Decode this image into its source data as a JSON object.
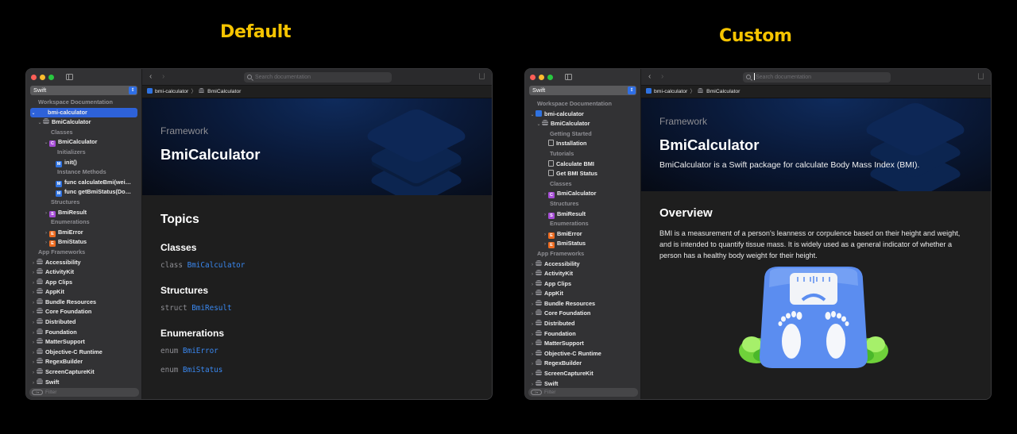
{
  "captions": {
    "left": "Default",
    "right": "Custom"
  },
  "windows": {
    "default": {
      "sidebar": {
        "language": "Swift",
        "filter_placeholder": "Filter",
        "tree": [
          {
            "label": "Workspace Documentation",
            "kind": "section",
            "indent": 0
          },
          {
            "label": "bmi-calculator",
            "kind": "item",
            "disclosure": "open",
            "icon": "none",
            "indent": 0,
            "selected": true
          },
          {
            "label": "BmiCalculator",
            "kind": "item",
            "disclosure": "open",
            "icon": "framework",
            "indent": 1
          },
          {
            "label": "Classes",
            "kind": "section",
            "indent": 2
          },
          {
            "label": "BmiCalculator",
            "kind": "item",
            "disclosure": "open",
            "icon": "C",
            "indent": 2
          },
          {
            "label": "Initializers",
            "kind": "section",
            "indent": 3
          },
          {
            "label": "init()",
            "kind": "item",
            "disclosure": "none",
            "icon": "M",
            "indent": 3
          },
          {
            "label": "Instance Methods",
            "kind": "section",
            "indent": 3
          },
          {
            "label": "func calculateBmi(wei…",
            "kind": "item",
            "disclosure": "none",
            "icon": "M",
            "indent": 3
          },
          {
            "label": "func getBmiStatus(Do…",
            "kind": "item",
            "disclosure": "none",
            "icon": "M",
            "indent": 3
          },
          {
            "label": "Structures",
            "kind": "section",
            "indent": 2
          },
          {
            "label": "BmiResult",
            "kind": "item",
            "disclosure": "closed",
            "icon": "S",
            "indent": 2
          },
          {
            "label": "Enumerations",
            "kind": "section",
            "indent": 2
          },
          {
            "label": "BmiError",
            "kind": "item",
            "disclosure": "closed",
            "icon": "E",
            "indent": 2
          },
          {
            "label": "BmiStatus",
            "kind": "item",
            "disclosure": "closed",
            "icon": "E",
            "indent": 2
          },
          {
            "label": "App Frameworks",
            "kind": "section",
            "indent": 0
          },
          {
            "label": "Accessibility",
            "kind": "item",
            "disclosure": "closed",
            "icon": "framework",
            "indent": 0
          },
          {
            "label": "ActivityKit",
            "kind": "item",
            "disclosure": "closed",
            "icon": "framework",
            "indent": 0
          },
          {
            "label": "App Clips",
            "kind": "item",
            "disclosure": "closed",
            "icon": "framework",
            "indent": 0
          },
          {
            "label": "AppKit",
            "kind": "item",
            "disclosure": "closed",
            "icon": "framework",
            "indent": 0
          },
          {
            "label": "Bundle Resources",
            "kind": "item",
            "disclosure": "closed",
            "icon": "framework",
            "indent": 0
          },
          {
            "label": "Core Foundation",
            "kind": "item",
            "disclosure": "closed",
            "icon": "framework",
            "indent": 0
          },
          {
            "label": "Distributed",
            "kind": "item",
            "disclosure": "closed",
            "icon": "framework",
            "indent": 0
          },
          {
            "label": "Foundation",
            "kind": "item",
            "disclosure": "closed",
            "icon": "framework",
            "indent": 0
          },
          {
            "label": "MatterSupport",
            "kind": "item",
            "disclosure": "closed",
            "icon": "framework",
            "indent": 0
          },
          {
            "label": "Objective-C Runtime",
            "kind": "item",
            "disclosure": "closed",
            "icon": "framework",
            "indent": 0
          },
          {
            "label": "RegexBuilder",
            "kind": "item",
            "disclosure": "closed",
            "icon": "framework",
            "indent": 0
          },
          {
            "label": "ScreenCaptureKit",
            "kind": "item",
            "disclosure": "closed",
            "icon": "framework",
            "indent": 0
          },
          {
            "label": "Swift",
            "kind": "item",
            "disclosure": "closed",
            "icon": "framework",
            "indent": 0
          }
        ]
      },
      "toolbar": {
        "search_placeholder": "Search documentation",
        "search_focused": false
      },
      "breadcrumb": {
        "package": "bmi-calculator",
        "module": "BmiCalculator"
      },
      "hero": {
        "eyebrow": "Framework",
        "title": "BmiCalculator"
      },
      "topics": {
        "title": "Topics",
        "groups": [
          {
            "heading": "Classes",
            "items": [
              {
                "keyword": "class",
                "name": "BmiCalculator"
              }
            ]
          },
          {
            "heading": "Structures",
            "items": [
              {
                "keyword": "struct",
                "name": "BmiResult"
              }
            ]
          },
          {
            "heading": "Enumerations",
            "items": [
              {
                "keyword": "enum",
                "name": "BmiError"
              },
              {
                "keyword": "enum",
                "name": "BmiStatus"
              }
            ]
          }
        ]
      }
    },
    "custom": {
      "sidebar": {
        "language": "Swift",
        "filter_placeholder": "Filter",
        "tree": [
          {
            "label": "Workspace Documentation",
            "kind": "section",
            "indent": 0
          },
          {
            "label": "bmi-calculator",
            "kind": "item",
            "disclosure": "open",
            "icon": "package",
            "indent": 0
          },
          {
            "label": "BmiCalculator",
            "kind": "item",
            "disclosure": "open",
            "icon": "framework",
            "indent": 1
          },
          {
            "label": "Getting Started",
            "kind": "section",
            "indent": 2
          },
          {
            "label": "Installation",
            "kind": "item",
            "disclosure": "none",
            "icon": "doc",
            "indent": 2
          },
          {
            "label": "Tutorials",
            "kind": "section",
            "indent": 2
          },
          {
            "label": "Calculate BMI",
            "kind": "item",
            "disclosure": "none",
            "icon": "doc",
            "indent": 2
          },
          {
            "label": "Get BMI Status",
            "kind": "item",
            "disclosure": "none",
            "icon": "doc",
            "indent": 2
          },
          {
            "label": "Classes",
            "kind": "section",
            "indent": 2
          },
          {
            "label": "BmiCalculator",
            "kind": "item",
            "disclosure": "closed",
            "icon": "C",
            "indent": 2
          },
          {
            "label": "Structures",
            "kind": "section",
            "indent": 2
          },
          {
            "label": "BmiResult",
            "kind": "item",
            "disclosure": "closed",
            "icon": "S",
            "indent": 2
          },
          {
            "label": "Enumerations",
            "kind": "section",
            "indent": 2
          },
          {
            "label": "BmiError",
            "kind": "item",
            "disclosure": "closed",
            "icon": "E",
            "indent": 2
          },
          {
            "label": "BmiStatus",
            "kind": "item",
            "disclosure": "closed",
            "icon": "E",
            "indent": 2
          },
          {
            "label": "App Frameworks",
            "kind": "section",
            "indent": 0
          },
          {
            "label": "Accessibility",
            "kind": "item",
            "disclosure": "closed",
            "icon": "framework",
            "indent": 0
          },
          {
            "label": "ActivityKit",
            "kind": "item",
            "disclosure": "closed",
            "icon": "framework",
            "indent": 0
          },
          {
            "label": "App Clips",
            "kind": "item",
            "disclosure": "closed",
            "icon": "framework",
            "indent": 0
          },
          {
            "label": "AppKit",
            "kind": "item",
            "disclosure": "closed",
            "icon": "framework",
            "indent": 0
          },
          {
            "label": "Bundle Resources",
            "kind": "item",
            "disclosure": "closed",
            "icon": "framework",
            "indent": 0
          },
          {
            "label": "Core Foundation",
            "kind": "item",
            "disclosure": "closed",
            "icon": "framework",
            "indent": 0
          },
          {
            "label": "Distributed",
            "kind": "item",
            "disclosure": "closed",
            "icon": "framework",
            "indent": 0
          },
          {
            "label": "Foundation",
            "kind": "item",
            "disclosure": "closed",
            "icon": "framework",
            "indent": 0
          },
          {
            "label": "MatterSupport",
            "kind": "item",
            "disclosure": "closed",
            "icon": "framework",
            "indent": 0
          },
          {
            "label": "Objective-C Runtime",
            "kind": "item",
            "disclosure": "closed",
            "icon": "framework",
            "indent": 0
          },
          {
            "label": "RegexBuilder",
            "kind": "item",
            "disclosure": "closed",
            "icon": "framework",
            "indent": 0
          },
          {
            "label": "ScreenCaptureKit",
            "kind": "item",
            "disclosure": "closed",
            "icon": "framework",
            "indent": 0
          },
          {
            "label": "Swift",
            "kind": "item",
            "disclosure": "closed",
            "icon": "framework",
            "indent": 0
          }
        ]
      },
      "toolbar": {
        "search_placeholder": "Search documentation",
        "search_focused": true
      },
      "breadcrumb": {
        "package": "bmi-calculator",
        "module": "BmiCalculator"
      },
      "hero": {
        "eyebrow": "Framework",
        "title": "BmiCalculator",
        "abstract": "BmiCalculator is a Swift package for calculate Body Mass Index (BMI)."
      },
      "overview": {
        "title": "Overview",
        "text": "BMI is a measurement of a person's leanness or corpulence based on their height and weight, and is intended to quantify tissue mass. It is widely used as a general indicator of whether a person has a healthy body weight for their height.",
        "image": "bathroom-scale-illustration"
      }
    }
  },
  "colors": {
    "caption": "#f5c400",
    "accent": "#2e62d9",
    "link": "#3a88f0",
    "class_icon": "#a64dd6",
    "enum_icon": "#ed6b20",
    "method_icon": "#2f72e0"
  }
}
